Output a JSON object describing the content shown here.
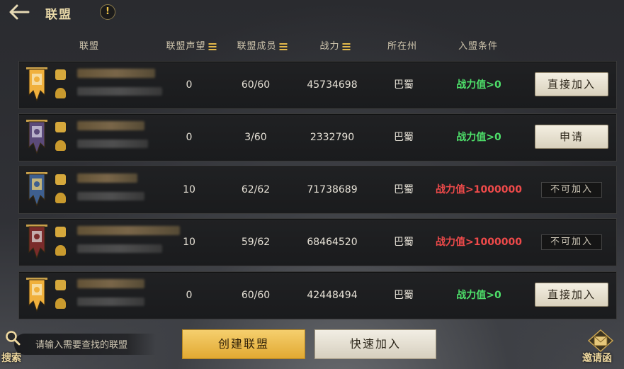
{
  "header": {
    "title": "联盟",
    "info_icon": "!"
  },
  "columns": {
    "alliance": "联盟",
    "reputation": "联盟声望",
    "members": "联盟成员",
    "power": "战力",
    "region": "所在州",
    "condition": "入盟条件"
  },
  "rows": [
    {
      "reputation": "0",
      "members": "60/60",
      "power": "45734698",
      "region": "巴蜀",
      "condition": "战力值>0",
      "condition_status": "ok",
      "action": "直接加入",
      "action_type": "join"
    },
    {
      "reputation": "0",
      "members": "3/60",
      "power": "2332790",
      "region": "巴蜀",
      "condition": "战力值>0",
      "condition_status": "ok",
      "action": "申请",
      "action_type": "join"
    },
    {
      "reputation": "10",
      "members": "62/62",
      "power": "71738689",
      "region": "巴蜀",
      "condition": "战力值>1000000",
      "condition_status": "bad",
      "action": "不可加入",
      "action_type": "disabled"
    },
    {
      "reputation": "10",
      "members": "59/62",
      "power": "68464520",
      "region": "巴蜀",
      "condition": "战力值>1000000",
      "condition_status": "bad",
      "action": "不可加入",
      "action_type": "disabled"
    },
    {
      "reputation": "0",
      "members": "60/60",
      "power": "42448494",
      "region": "巴蜀",
      "condition": "战力值>0",
      "condition_status": "ok",
      "action": "直接加入",
      "action_type": "join"
    }
  ],
  "footer": {
    "search_label": "搜索",
    "search_placeholder": "请输入需要查找的联盟",
    "create_button": "创建联盟",
    "quick_join_button": "快速加入",
    "invite_label": "邀请函"
  },
  "colors": {
    "condition_ok": "#4ee06a",
    "condition_bad": "#ef4a4a",
    "accent_gold": "#e3b84a"
  }
}
